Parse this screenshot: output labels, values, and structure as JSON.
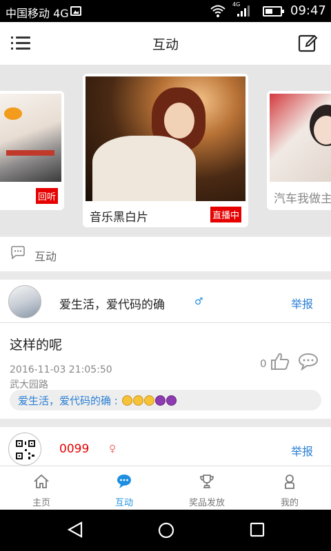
{
  "status_bar": {
    "carrier": "中国移动 4G",
    "time": "09:47",
    "net_label": "4G"
  },
  "header": {
    "title": "互动",
    "menu_icon": "menu-icon",
    "edit_icon": "edit-icon"
  },
  "carousel": {
    "left_card": {
      "tag": "回听"
    },
    "center_card": {
      "title": "音乐黑白片",
      "tag": "直播中"
    },
    "right_card": {
      "title": "汽车我做主"
    }
  },
  "section": {
    "label": "互动",
    "icon": "chat-icon"
  },
  "posts": [
    {
      "username": "爱生活，爱代码的确",
      "gender_symbol": "♂",
      "report": "举报",
      "content": "这样的呢",
      "time": "2016-11-03 21:05:50",
      "location": "武大园路",
      "likes": "0",
      "reply_author": "爱生活，爱代码的确 :"
    },
    {
      "username": "0099",
      "gender_symbol": "♀",
      "report": "举报"
    }
  ],
  "tabs": [
    {
      "label": "主页",
      "icon": "home-icon"
    },
    {
      "label": "互动",
      "icon": "chat-bubble-icon"
    },
    {
      "label": "奖品发放",
      "icon": "trophy-icon"
    },
    {
      "label": "我的",
      "icon": "user-icon"
    }
  ],
  "colors": {
    "accent": "#1e8fe0",
    "link": "#2a7fd4",
    "live_tag": "#e60000",
    "username_red": "#e60000"
  }
}
